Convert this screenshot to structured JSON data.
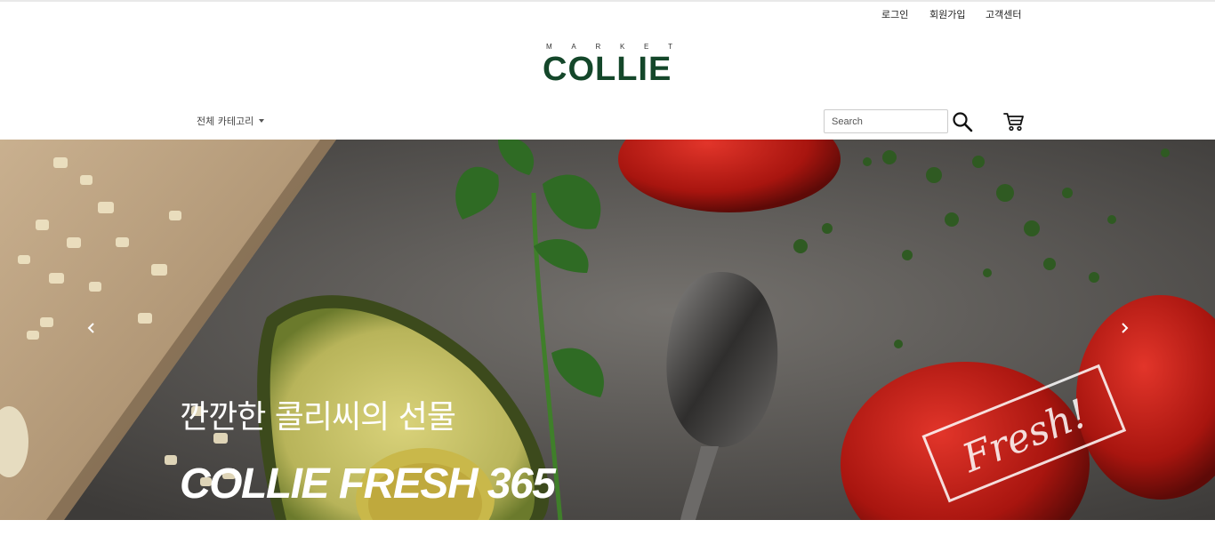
{
  "util_nav": {
    "login": "로그인",
    "signup": "회원가입",
    "support": "고객센터"
  },
  "logo": {
    "tagline_letters": [
      "M",
      "A",
      "R",
      "K",
      "E",
      "T"
    ],
    "wordmark": "COLLIE",
    "brand_color": "#14472a"
  },
  "nav": {
    "category_label": "전체 카테고리"
  },
  "search": {
    "placeholder": "Search",
    "value": ""
  },
  "icons": {
    "search": "magnifier-icon",
    "cart": "shopping-cart-icon",
    "prev": "chevron-left-icon",
    "next": "chevron-right-icon"
  },
  "hero": {
    "subtitle": "깐깐한 콜리씨의 선물",
    "title": "COLLIE FRESH 365",
    "stamp": "Fresh!"
  }
}
